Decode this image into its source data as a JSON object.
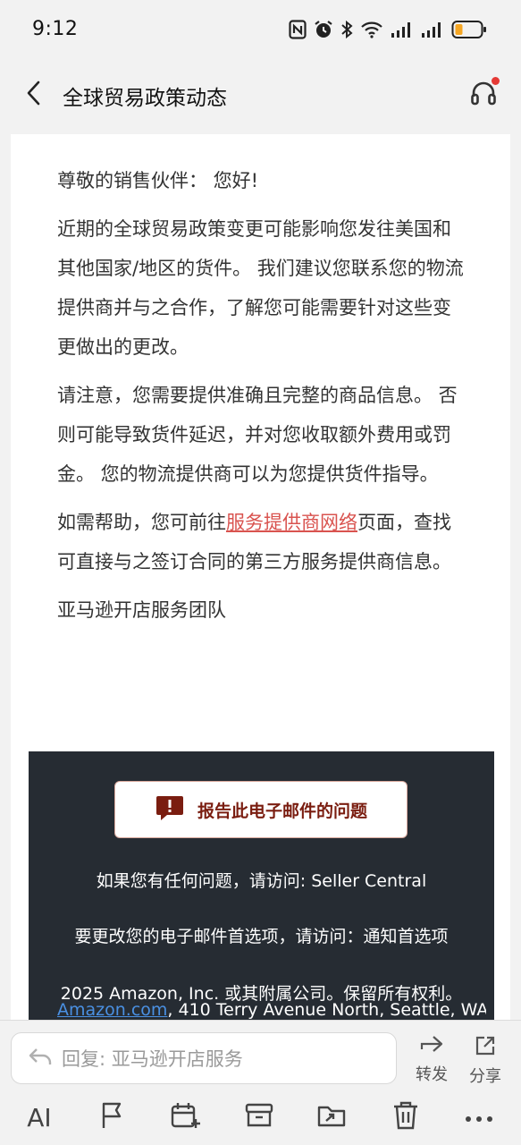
{
  "status_bar": {
    "time": "9:12",
    "icons": [
      "nfc-icon",
      "alarm-icon",
      "bluetooth-icon",
      "wifi-icon",
      "signal-icon",
      "signal-icon",
      "battery-icon"
    ]
  },
  "header": {
    "title": "全球贸易政策动态",
    "back_icon": "chevron-left-icon",
    "support_icon": "headset-icon"
  },
  "email": {
    "greeting": "尊敬的销售伙伴： 您好!",
    "paragraph1": "近期的全球贸易政策变更可能影响您发往美国和其他国家/地区的货件。 我们建议您联系您的物流提供商并与之合作，了解您可能需要针对这些变更做出的更改。",
    "paragraph2": "请注意，您需要提供准确且完整的商品信息。 否则可能导致货件延迟，并对您收取额外费用或罚金。 您的物流提供商可以为您提供货件指导。",
    "paragraph3_prefix": "如需帮助，您可前往",
    "paragraph3_link": "服务提供商网络",
    "paragraph3_suffix": "页面，查找可直接与之签订合同的第三方服务提供商信息。",
    "signature": "亚马逊开店服务团队"
  },
  "footer": {
    "report_label": "报告此电子邮件的问题",
    "help_line": "如果您有任何问题，请访问: Seller Central",
    "prefs_line": "要更改您的电子邮件首选项，请访问：通知首选项",
    "copyright_line": "2025 Amazon, Inc. 或其附属公司。保留所有权利。",
    "amazon_link": "Amazon.com",
    "address": ", 410 Terry Avenue North, Seattle, WA"
  },
  "reply_bar": {
    "placeholder": "回复: 亚马逊开店服务",
    "forward_label": "转发",
    "share_label": "分享"
  },
  "toolbar": {
    "ai_label": "AI"
  },
  "colors": {
    "link": "#d9534f",
    "footer_bg": "#262c33",
    "report_text": "#7a1d10",
    "amazon_link": "#4a90e2",
    "battery_fill": "#f5a623"
  }
}
